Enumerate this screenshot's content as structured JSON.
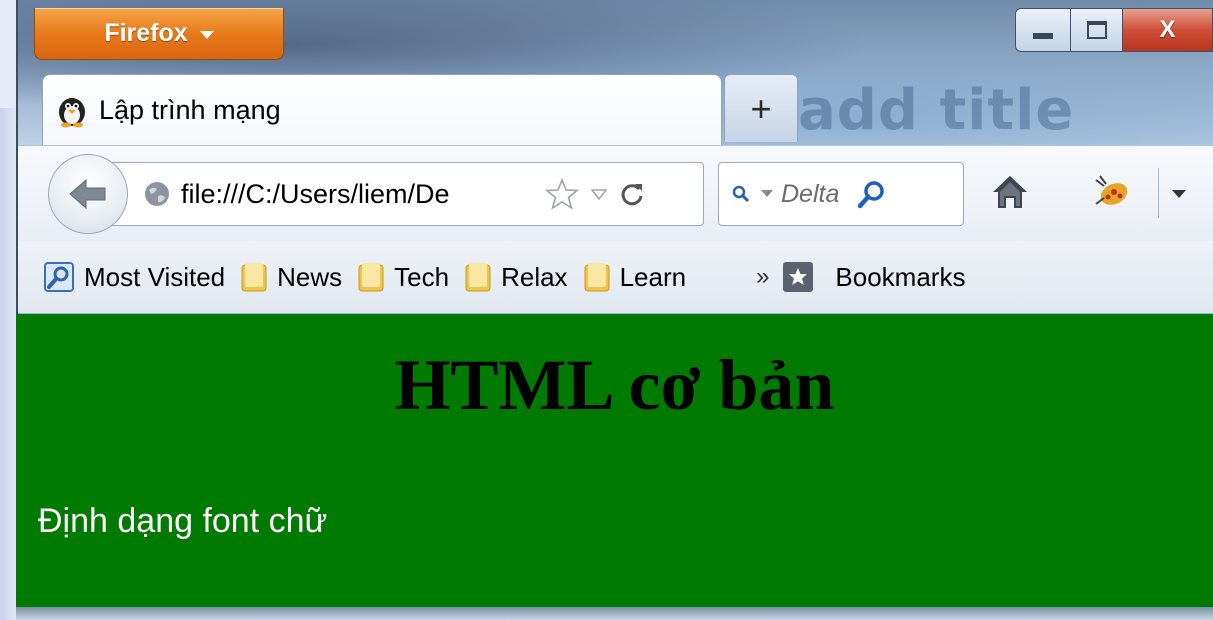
{
  "app": {
    "menu_button_label": "Firefox",
    "close_glyph": "X",
    "new_tab_glyph": "+"
  },
  "tab": {
    "title": "Lập trình mạng"
  },
  "background_title_ghost": "add title",
  "navbar": {
    "url": "file:///C:/Users/liem/De",
    "search_engine": "Delta"
  },
  "bookmarks": {
    "items": [
      "Most Visited",
      "News",
      "Tech",
      "Relax",
      "Learn"
    ],
    "overflow": "»",
    "menu_label": "Bookmarks"
  },
  "page": {
    "heading": "HTML cơ bản",
    "paragraph": "Định dạng font chữ",
    "background_color": "#007a00"
  },
  "colors": {
    "firefox_button": "#e77a1a",
    "close_button": "#cf4f38"
  },
  "icons": [
    "penguin-favicon-icon",
    "back-arrow-icon",
    "globe-icon",
    "star-icon",
    "dropdown-arrow-icon",
    "reload-icon",
    "search-engine-icon",
    "search-icon",
    "home-icon",
    "bug-addon-icon",
    "most-visited-icon",
    "folder-icon",
    "bookmarks-star-icon"
  ]
}
